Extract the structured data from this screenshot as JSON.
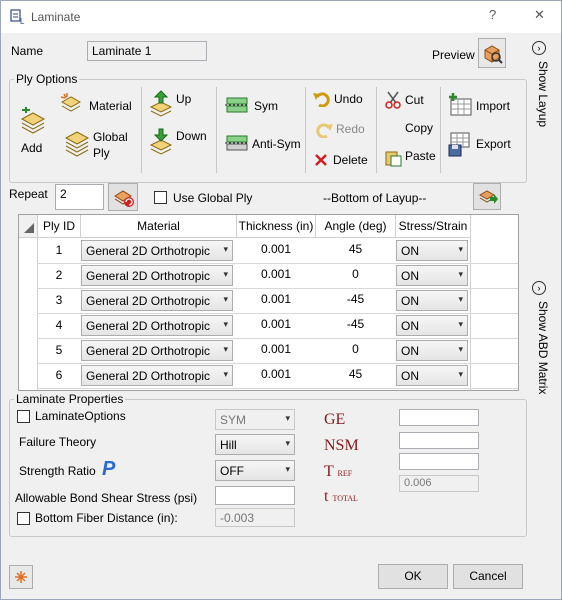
{
  "window": {
    "title": "Laminate",
    "help_glyph": "?",
    "close_glyph": "✕"
  },
  "name": {
    "label": "Name",
    "value": "Laminate 1"
  },
  "preview": {
    "label": "Preview"
  },
  "side_tabs": {
    "show_layup": "Show Layup",
    "show_abd": "Show ABD Matrix"
  },
  "ply_options": {
    "title": "Ply Options",
    "add": "Add",
    "material": "Material",
    "global_ply": "Global Ply",
    "up": "Up",
    "down": "Down",
    "sym": "Sym",
    "anti_sym": "Anti-Sym",
    "undo": "Undo",
    "redo": "Redo",
    "delete": "Delete",
    "cut": "Cut",
    "copy": "Copy",
    "paste": "Paste",
    "import": "Import",
    "export": "Export"
  },
  "repeat": {
    "label": "Repeat",
    "value": "2"
  },
  "use_global_ply": {
    "label": "Use Global Ply",
    "checked": false
  },
  "bottom_of_layup": "--Bottom of Layup--",
  "table": {
    "columns": [
      "Ply ID",
      "Material",
      "Thickness (in)",
      "Angle (deg)",
      "Stress/Strain"
    ],
    "rows": [
      {
        "id": "1",
        "material": "General 2D Orthotropic",
        "thickness": "0.001",
        "angle": "45",
        "stress": "ON"
      },
      {
        "id": "2",
        "material": "General 2D Orthotropic",
        "thickness": "0.001",
        "angle": "0",
        "stress": "ON"
      },
      {
        "id": "3",
        "material": "General 2D Orthotropic",
        "thickness": "0.001",
        "angle": "-45",
        "stress": "ON"
      },
      {
        "id": "4",
        "material": "General 2D Orthotropic",
        "thickness": "0.001",
        "angle": "-45",
        "stress": "ON"
      },
      {
        "id": "5",
        "material": "General 2D Orthotropic",
        "thickness": "0.001",
        "angle": "0",
        "stress": "ON"
      },
      {
        "id": "6",
        "material": "General 2D Orthotropic",
        "thickness": "0.001",
        "angle": "45",
        "stress": "ON"
      }
    ]
  },
  "laminate_properties": {
    "title": "Laminate Properties",
    "laminate_options_label": "LaminateOptions",
    "laminate_options_value": "SYM",
    "failure_theory_label": "Failure Theory",
    "failure_theory_value": "Hill",
    "strength_ratio_label": "Strength Ratio",
    "strength_ratio_symbol": "P",
    "strength_ratio_value": "OFF",
    "bond_shear_label": "Allowable Bond Shear Stress (psi)",
    "bond_shear_value": "",
    "bottom_fiber_label": "Bottom Fiber Distance (in):",
    "bottom_fiber_value": "-0.003",
    "ge_label": "GE",
    "nsm_label": "NSM",
    "tref_label": "T",
    "tref_sub": "REF",
    "ttotal_label": "t",
    "ttotal_sub": "TOTAL",
    "ge_value": "",
    "nsm_value": "",
    "tref_value": "",
    "ttotal_value": "0.006"
  },
  "buttons": {
    "ok": "OK",
    "cancel": "Cancel"
  }
}
